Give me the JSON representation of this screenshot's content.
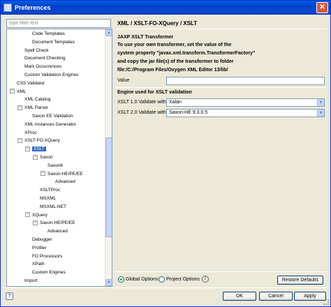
{
  "window": {
    "title": "Preferences",
    "close_label": "✕"
  },
  "filter": {
    "placeholder": "type filter text"
  },
  "tree": [
    {
      "label": "Code Templates",
      "indent": 2,
      "expander": ""
    },
    {
      "label": "Document Templates",
      "indent": 2,
      "expander": ""
    },
    {
      "label": "Spell Check",
      "indent": 1,
      "expander": ""
    },
    {
      "label": "Document Checking",
      "indent": 1,
      "expander": ""
    },
    {
      "label": "Mark Occurrences",
      "indent": 1,
      "expander": ""
    },
    {
      "label": "Custom Validation Engines",
      "indent": 1,
      "expander": ""
    },
    {
      "label": "CSS Validator",
      "indent": 0,
      "expander": ""
    },
    {
      "label": "XML",
      "indent": 0,
      "expander": "−"
    },
    {
      "label": "XML Catalog",
      "indent": 1,
      "expander": ""
    },
    {
      "label": "XML Parser",
      "indent": 1,
      "expander": "−"
    },
    {
      "label": "Saxon EE Validation",
      "indent": 2,
      "expander": ""
    },
    {
      "label": "XML Instances Generator",
      "indent": 1,
      "expander": ""
    },
    {
      "label": "XProc",
      "indent": 1,
      "expander": ""
    },
    {
      "label": "XSLT-FO-XQuery",
      "indent": 1,
      "expander": "−"
    },
    {
      "label": "XSLT",
      "indent": 2,
      "expander": "−",
      "selected": true
    },
    {
      "label": "Saxon",
      "indent": 3,
      "expander": "−"
    },
    {
      "label": "Saxon6",
      "indent": 4,
      "expander": ""
    },
    {
      "label": "Saxon-HE/PE/EE",
      "indent": 4,
      "expander": "−"
    },
    {
      "label": "Advanced",
      "indent": 5,
      "expander": ""
    },
    {
      "label": "XSLTProc",
      "indent": 3,
      "expander": ""
    },
    {
      "label": "MSXML",
      "indent": 3,
      "expander": ""
    },
    {
      "label": "MSXML.NET",
      "indent": 3,
      "expander": ""
    },
    {
      "label": "XQuery",
      "indent": 2,
      "expander": "−"
    },
    {
      "label": "Saxon-HE/PE/EE",
      "indent": 3,
      "expander": "−"
    },
    {
      "label": "Advanced",
      "indent": 4,
      "expander": ""
    },
    {
      "label": "Debugger",
      "indent": 2,
      "expander": ""
    },
    {
      "label": "Profiler",
      "indent": 2,
      "expander": ""
    },
    {
      "label": "FO Processors",
      "indent": 2,
      "expander": ""
    },
    {
      "label": "XPath",
      "indent": 2,
      "expander": ""
    },
    {
      "label": "Custom Engines",
      "indent": 2,
      "expander": ""
    },
    {
      "label": "Import",
      "indent": 1,
      "expander": ""
    }
  ],
  "page": {
    "title": "XML / XSLT-FO-XQuery / XSLT",
    "jaxp_heading": "JAXP XSLT Transformer",
    "jaxp_lines": [
      "To use your own transformer, set the value of the",
      "system property \"javax.xml.transform.TransformerFactory\"",
      "and copy the jar file(s) of the transformer to folder",
      "file:/C:/Program Files/Oxygen XML Editor 13/lib/"
    ],
    "value_label": "Value",
    "value_text": "",
    "engine_heading": "Engine used for XSLT validation",
    "xslt1_label": "XSLT 1.0 Validate with",
    "xslt1_value": "Xalan",
    "xslt2_label": "XSLT 2.0 Validate with",
    "xslt2_value": "Saxon-HE 9.3.0.5"
  },
  "options": {
    "global_label": "Global Options",
    "project_label": "Project Options",
    "info_glyph": "i",
    "restore_label": "Restore Defaults"
  },
  "footer": {
    "help_glyph": "?",
    "ok_label": "OK",
    "cancel_label": "Cancel",
    "apply_label": "Apply"
  }
}
